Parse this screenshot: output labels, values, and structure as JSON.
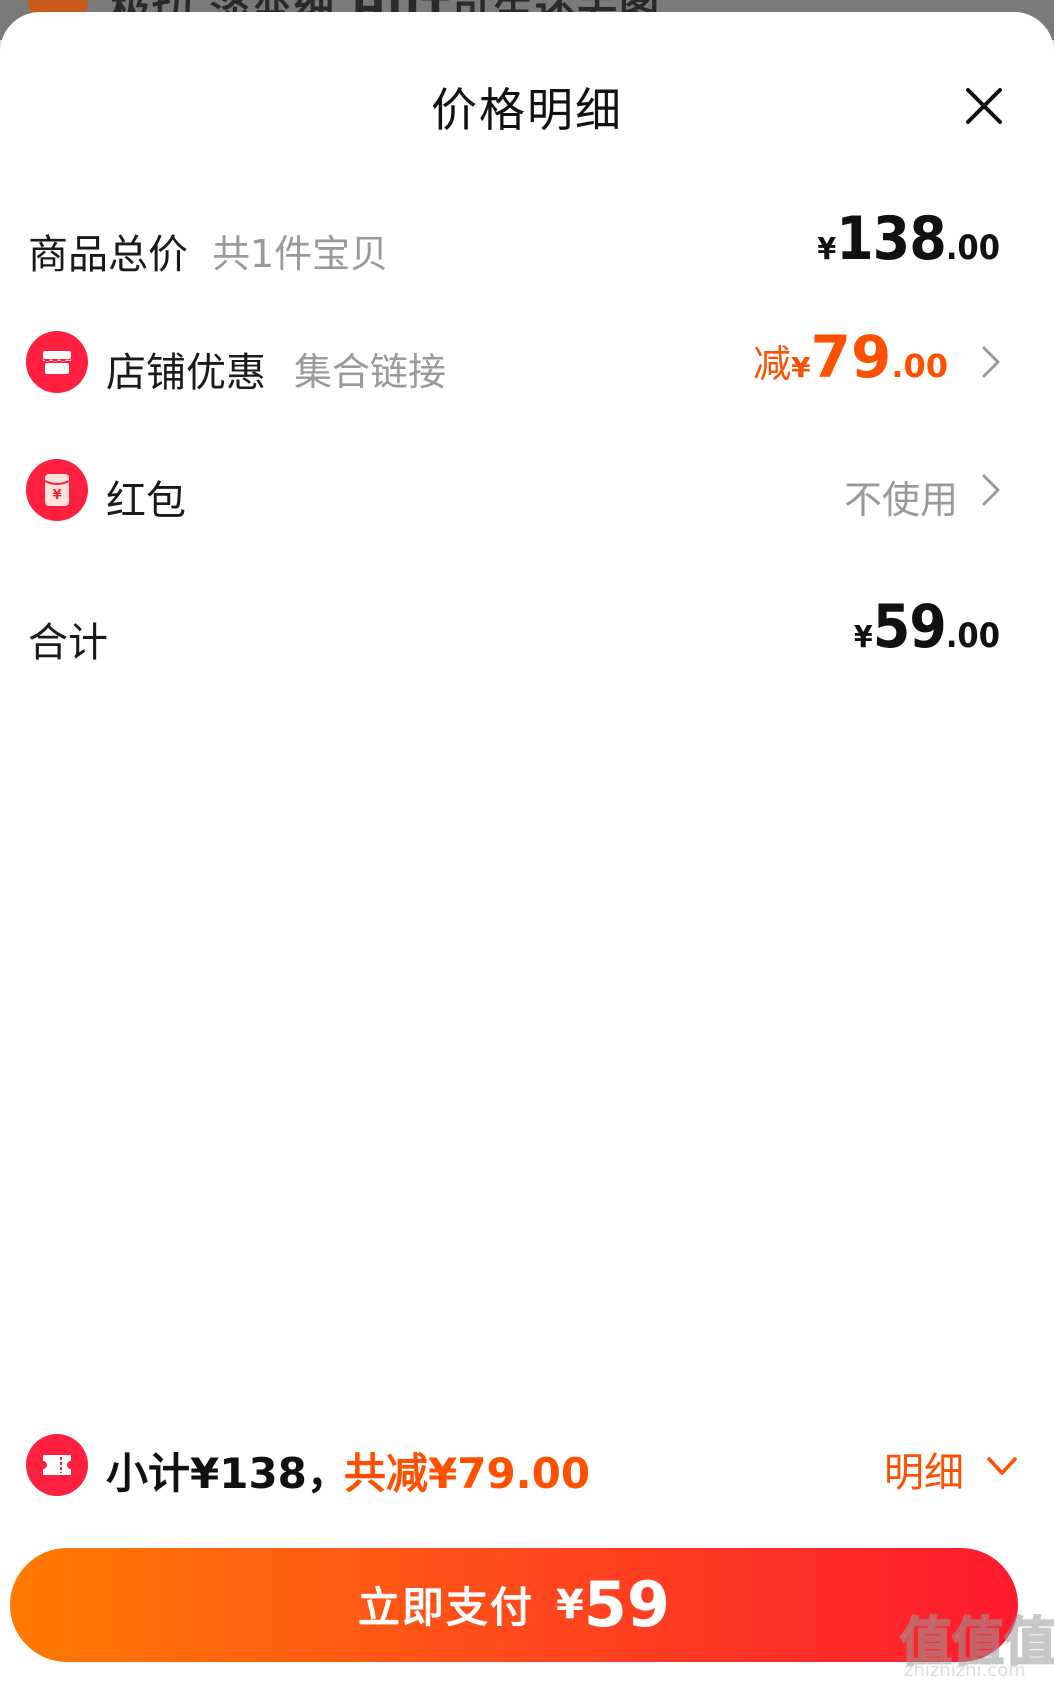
{
  "underlay": {
    "text": "极切 淡变细 HUT可生还去图"
  },
  "sheet": {
    "title": "价格明细"
  },
  "rows": {
    "goods_total": {
      "label": "商品总价",
      "sub": "共1件宝贝",
      "yen": "¥",
      "int": "138",
      "dec": ".00"
    },
    "shop_discount": {
      "label": "店铺优惠",
      "sub": "集合链接",
      "prefix": "减",
      "yen": "¥",
      "int": "79",
      "dec": ".00",
      "icon": "shop-icon"
    },
    "red_packet": {
      "label": "红包",
      "value": "不使用",
      "icon": "red-packet-icon"
    },
    "total": {
      "label": "合计",
      "yen": "¥",
      "int": "59",
      "dec": ".00"
    }
  },
  "summary": {
    "subtotal": "小计¥138，",
    "discount": "共减¥79.00",
    "detail_label": "明细",
    "icon": "coupon-icon"
  },
  "pay_button": {
    "label": "立即支付",
    "yen": "¥",
    "amount": "59"
  },
  "watermark": {
    "main": "值值值",
    "sub": "zhizhizhi.com"
  },
  "colors": {
    "accent": "#ff5000",
    "brand_red": "#ff1f3f",
    "button_start": "#ff7a00",
    "button_end": "#ff1a2e"
  }
}
